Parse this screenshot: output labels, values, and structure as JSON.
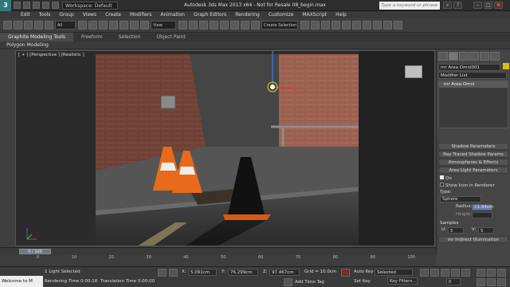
{
  "titlebar": {
    "workspace": "Workspace: Default",
    "title": "Autodesk 3ds Max 2013 x64 - Not for Resale  08_begin.max",
    "search_placeholder": "Type a keyword or phrase"
  },
  "menu": [
    "Edit",
    "Tools",
    "Group",
    "Views",
    "Create",
    "Modifiers",
    "Animation",
    "Graph Editors",
    "Rendering",
    "Customize",
    "MAXScript",
    "Help"
  ],
  "toolbar": {
    "filter_select": "All",
    "view_select": "View",
    "selection_set": "Create Selection"
  },
  "ribbon": {
    "tabs": [
      "Graphite Modeling Tools",
      "Freeform",
      "Selection",
      "Object Paint"
    ],
    "sub_label": "Polygon Modeling"
  },
  "viewport": {
    "label": "[ + ] [Perspective ] [Realistic ]"
  },
  "panel": {
    "object_name": "mr Area Omni001",
    "modifier_list": "Modifier List",
    "stack_item": "mr Area Omni",
    "rollouts": [
      "Shadow Parameters",
      "Ray Traced Shadow Params",
      "Atmospheres & Effects",
      "Area Light Parameters"
    ],
    "on_label": "On",
    "show_icon_label": "Show Icon in Renderer",
    "type_label": "Type:",
    "type_value": "Sphere",
    "radius_label": "Radius:",
    "radius_value": "11.94cm",
    "height_label": "Height:",
    "samples_label": "Samples",
    "u_label": "U:",
    "u_value": "5",
    "v_label": "V:",
    "v_value": "5",
    "bottom_rollout": "mr Indirect Illumination"
  },
  "timeline": {
    "slider_label": "0 / 100",
    "ticks": [
      "0",
      "10",
      "20",
      "30",
      "40",
      "50",
      "60",
      "70",
      "80",
      "90",
      "100"
    ]
  },
  "status": {
    "maxscript": "Welcome to M",
    "selection": "1 Light Selected",
    "render_time": "Rendering Time  0:00:18",
    "translation_time": "Translation Time  0:00:00",
    "x_label": "X:",
    "x_value": "5.091cm",
    "y_label": "Y:",
    "y_value": "76.299cm",
    "z_label": "Z:",
    "z_value": "97.467cm",
    "grid": "Grid = 10.0cm",
    "add_time_tag": "Add Time Tag",
    "auto_key": "Auto Key",
    "selected": "Selected",
    "set_key": "Set Key",
    "key_filters": "Key Filters...",
    "frame": "0"
  }
}
